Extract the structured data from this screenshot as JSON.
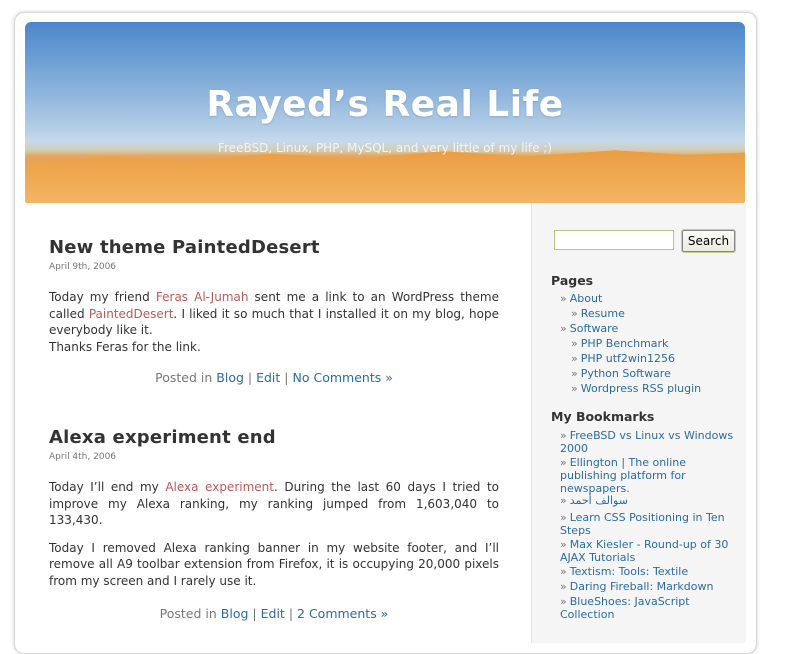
{
  "header": {
    "title": "Rayed’s Real Life",
    "description": "FreeBSD, Linux, PHP, MySQL, and very little of my life ;)"
  },
  "posts": [
    {
      "title": "New theme PaintedDesert",
      "date": "April 9th, 2006",
      "body": {
        "p1_pre": "Today my friend ",
        "link1": "Feras Al-Jumah",
        "p1_mid": " sent me a link to an WordPress theme called ",
        "link2": "PaintedDesert",
        "p1_post": ". I liked it so much that I installed it on my blog, hope everybody like it.",
        "p2": "Thanks Feras for the link."
      },
      "meta": {
        "posted_in": "Posted in",
        "category": "Blog",
        "edit": "Edit",
        "comments": "No Comments »"
      }
    },
    {
      "title": "Alexa experiment end",
      "date": "April 4th, 2006",
      "body": {
        "p1_pre": "Today I’ll end my ",
        "link1": "Alexa experiment",
        "p1_post": ". During the last 60 days I tried to improve my Alexa ranking, my ranking jumped from 1,603,040 to 133,430.",
        "p2": "Today I removed Alexa ranking banner in my website footer, and I’ll remove all A9 toolbar extension from Firefox, it is occupying 20,000 pixels from my screen and I rarely use it."
      },
      "meta": {
        "posted_in": "Posted in",
        "category": "Blog",
        "edit": "Edit",
        "comments": "2 Comments »"
      }
    }
  ],
  "sidebar": {
    "search": {
      "button": "Search",
      "value": "",
      "placeholder": ""
    },
    "pages_title": "Pages",
    "pages": [
      {
        "label": "About",
        "level": 0
      },
      {
        "label": "Resume",
        "level": 1
      },
      {
        "label": "Software",
        "level": 0
      },
      {
        "label": "PHP Benchmark",
        "level": 1
      },
      {
        "label": "PHP utf2win1256",
        "level": 1
      },
      {
        "label": "Python Software",
        "level": 1
      },
      {
        "label": "Wordpress RSS plugin",
        "level": 1
      }
    ],
    "bookmarks_title": "My Bookmarks",
    "bookmarks": [
      "FreeBSD vs Linux vs Windows 2000",
      "Ellington | The online publishing platform for newspapers.",
      "سوالف أحمد",
      "Learn CSS Positioning in Ten Steps",
      "Max Kiesler - Round-up of 30 AJAX Tutorials",
      "Textism: Tools: Textile",
      "Daring Fireball: Markdown",
      "BlueShoes: JavaScript Collection"
    ],
    "separator": "»"
  },
  "colors": {
    "link_red": "#b85b5a",
    "link_blue": "#2b6ba2",
    "sidebar_bg": "#f5f5f5"
  }
}
